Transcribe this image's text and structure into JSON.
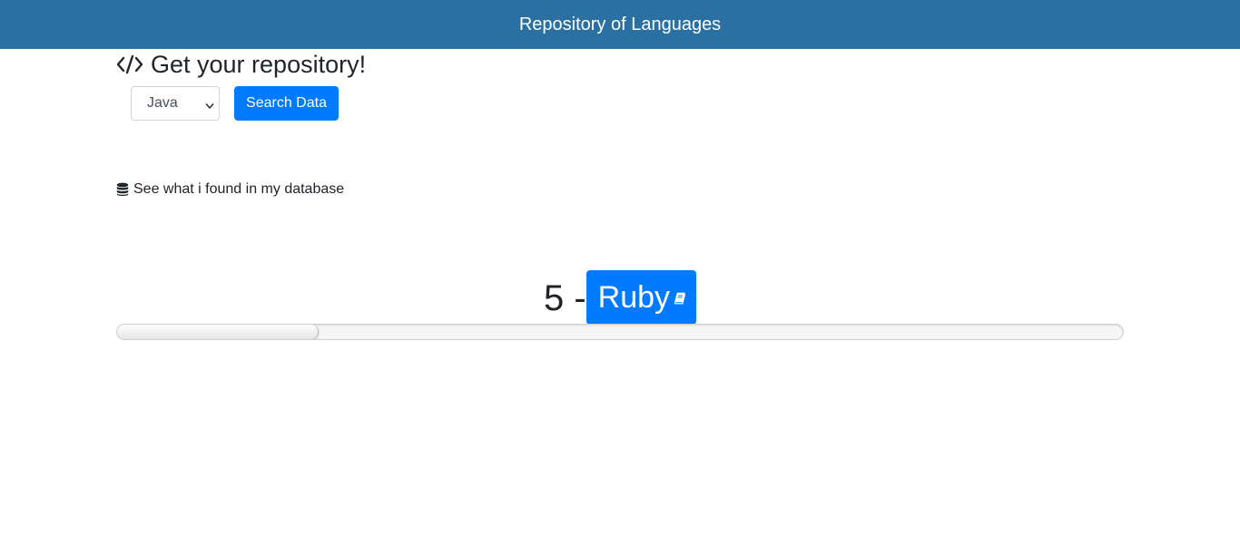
{
  "navbar": {
    "title": "Repository of Languages",
    "background": "#2a70a3"
  },
  "heading": {
    "icon": "code-icon",
    "text": "Get your repository!"
  },
  "search": {
    "language_select": {
      "selected": "Java"
    },
    "button_label": "Search Data",
    "button_color": "#007bff"
  },
  "database": {
    "icon": "database-icon",
    "text": "See what i found in my database"
  },
  "result": {
    "number_text": "5 -",
    "language": "Ruby",
    "icon": "book-icon",
    "badge_color": "#007bff"
  },
  "progress": {
    "value_fraction": 0.2
  }
}
